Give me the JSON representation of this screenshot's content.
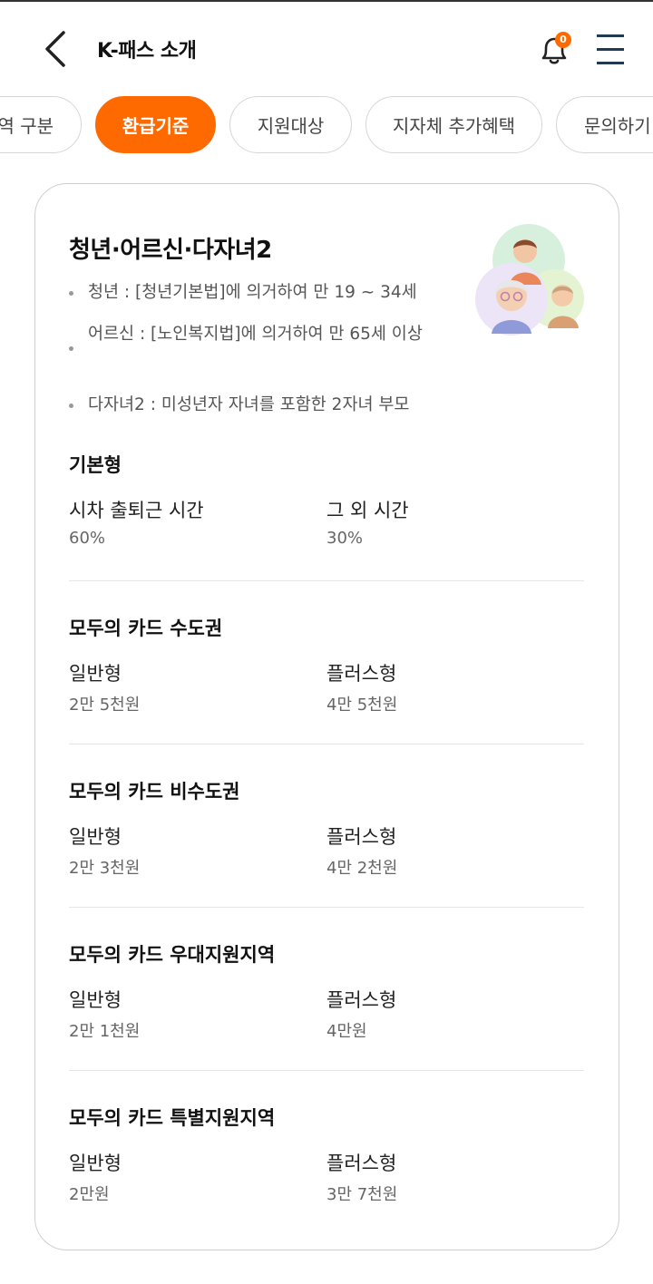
{
  "header": {
    "title": "K-패스 소개",
    "notification_count": "0",
    "icons": [
      "back-chevron-icon",
      "bell-icon",
      "menu-icon"
    ]
  },
  "tabs": [
    {
      "label": "역 구분",
      "active": false
    },
    {
      "label": "환급기준",
      "active": true
    },
    {
      "label": "지원대상",
      "active": false
    },
    {
      "label": "지자체 추가혜택",
      "active": false
    },
    {
      "label": "문의하기",
      "active": false
    }
  ],
  "card": {
    "title": "청년·어르신·다자녀2",
    "bullets": [
      "청년 : [청년기본법]에 의거하여 만 19 ~ 34세",
      "어르신 : [노인복지법]에 의거하여 만 65세 이상",
      "다자녀2 : 미성년자 자녀를 포함한 2자녀 부모"
    ],
    "sections": [
      {
        "title": "기본형",
        "left_label": "시차 출퇴근 시간",
        "left_value": "60%",
        "right_label": "그 외 시간",
        "right_value": "30%"
      },
      {
        "title": "모두의 카드 수도권",
        "left_label": "일반형",
        "left_value": "2만 5천원",
        "right_label": "플러스형",
        "right_value": "4만 5천원"
      },
      {
        "title": "모두의 카드 비수도권",
        "left_label": "일반형",
        "left_value": "2만 3천원",
        "right_label": "플러스형",
        "right_value": "4만 2천원"
      },
      {
        "title": "모두의 카드 우대지원지역",
        "left_label": "일반형",
        "left_value": "2만 1천원",
        "right_label": "플러스형",
        "right_value": "4만원"
      },
      {
        "title": "모두의 카드 특별지원지역",
        "left_label": "일반형",
        "left_value": "2만원",
        "right_label": "플러스형",
        "right_value": "3만 7천원"
      }
    ]
  },
  "colors": {
    "accent": "#ff6a00",
    "border": "#cfcfcf",
    "divider": "#e6e6e6"
  }
}
